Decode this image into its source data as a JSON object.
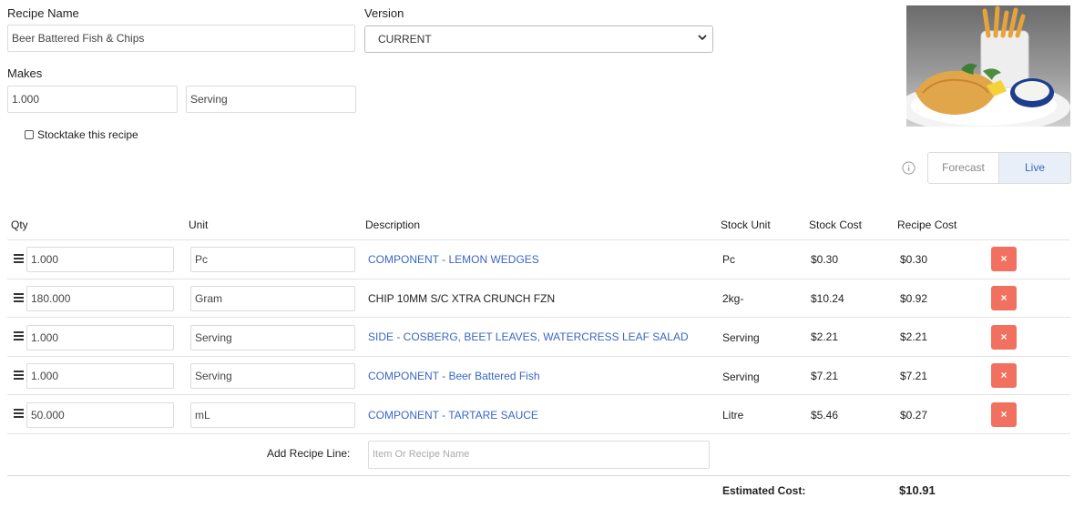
{
  "recipe": {
    "name_label": "Recipe Name",
    "name_value": "Beer Battered Fish & Chips",
    "version_label": "Version",
    "version_value": "CURRENT",
    "makes_label": "Makes",
    "makes_qty": "1.000",
    "makes_unit": "Serving",
    "stocktake_label": "Stocktake this recipe",
    "stocktake_checked": false
  },
  "toggle": {
    "forecast": "Forecast",
    "live": "Live",
    "active": "live",
    "info_icon": "info-icon"
  },
  "table": {
    "headers": {
      "qty": "Qty",
      "unit": "Unit",
      "description": "Description",
      "stock_unit": "Stock Unit",
      "stock_cost": "Stock Cost",
      "recipe_cost": "Recipe Cost"
    },
    "rows": [
      {
        "qty": "1.000",
        "unit": "Pc",
        "description": "COMPONENT - LEMON WEDGES",
        "is_link": true,
        "stock_unit": "Pc",
        "stock_cost": "$0.30",
        "recipe_cost": "$0.30"
      },
      {
        "qty": "180.000",
        "unit": "Gram",
        "description": "CHIP 10MM S/C XTRA CRUNCH FZN",
        "is_link": false,
        "stock_unit": "2kg-",
        "stock_cost": "$10.24",
        "recipe_cost": "$0.92"
      },
      {
        "qty": "1.000",
        "unit": "Serving",
        "description": "SIDE - COSBERG, BEET LEAVES, WATERCRESS LEAF SALAD",
        "is_link": true,
        "stock_unit": "Serving",
        "stock_cost": "$2.21",
        "recipe_cost": "$2.21"
      },
      {
        "qty": "1.000",
        "unit": "Serving",
        "description": "COMPONENT - Beer Battered Fish",
        "is_link": true,
        "stock_unit": "Serving",
        "stock_cost": "$7.21",
        "recipe_cost": "$7.21"
      },
      {
        "qty": "50.000",
        "unit": "mL",
        "description": "COMPONENT - TARTARE SAUCE",
        "is_link": true,
        "stock_unit": "Litre",
        "stock_cost": "$5.46",
        "recipe_cost": "$0.27"
      }
    ],
    "delete_glyph": "×",
    "add_line_label": "Add Recipe Line:",
    "add_line_placeholder": "Item Or Recipe Name",
    "estimated_label": "Estimated Cost:",
    "estimated_value": "$10.91"
  },
  "colors": {
    "link": "#3a66c4",
    "delete": "#f2705f",
    "toggle_active_bg": "#e8eff9",
    "toggle_active_text": "#3a66c4"
  },
  "image": {
    "subject": "plate of battered fish with chips, lemon and tartare sauce"
  }
}
